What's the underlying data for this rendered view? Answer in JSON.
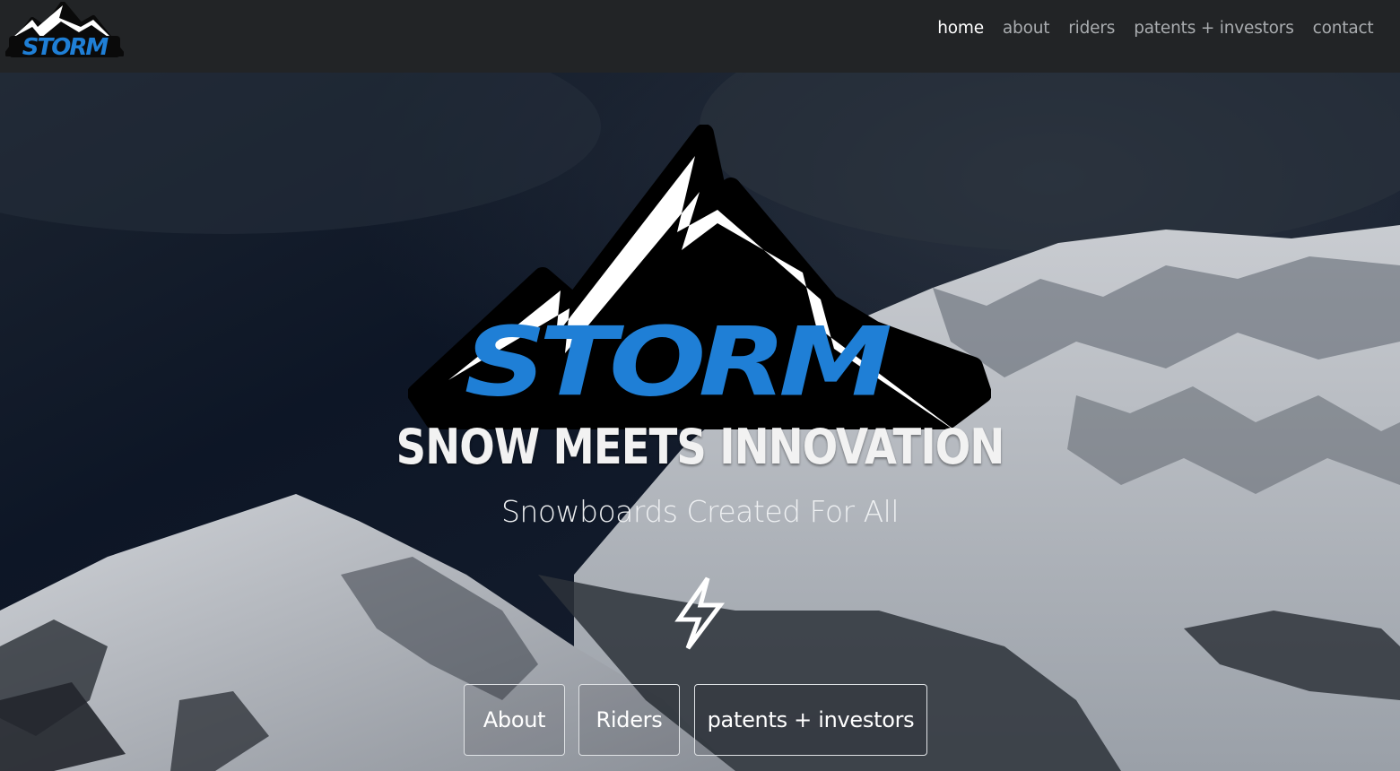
{
  "nav": {
    "logo_text": "STORM",
    "links": [
      {
        "label": "home",
        "active": true
      },
      {
        "label": "about",
        "active": false
      },
      {
        "label": "riders",
        "active": false
      },
      {
        "label": "patents + investors",
        "active": false
      },
      {
        "label": "contact",
        "active": false
      }
    ]
  },
  "hero": {
    "logo_text": "STORM",
    "tagline": "SNOW MEETS INNOVATION",
    "subtitle": "Snowboards Created For All",
    "icon": "lightning-bolt-icon",
    "buttons": [
      {
        "label": "About"
      },
      {
        "label": "Riders"
      },
      {
        "label": "patents + investors"
      }
    ]
  },
  "colors": {
    "navbar_bg": "#222426",
    "nav_link": "#a9acaf",
    "nav_link_active": "#ffffff",
    "brand_blue": "#1f7fd6",
    "text_light": "#f2f2f2"
  }
}
